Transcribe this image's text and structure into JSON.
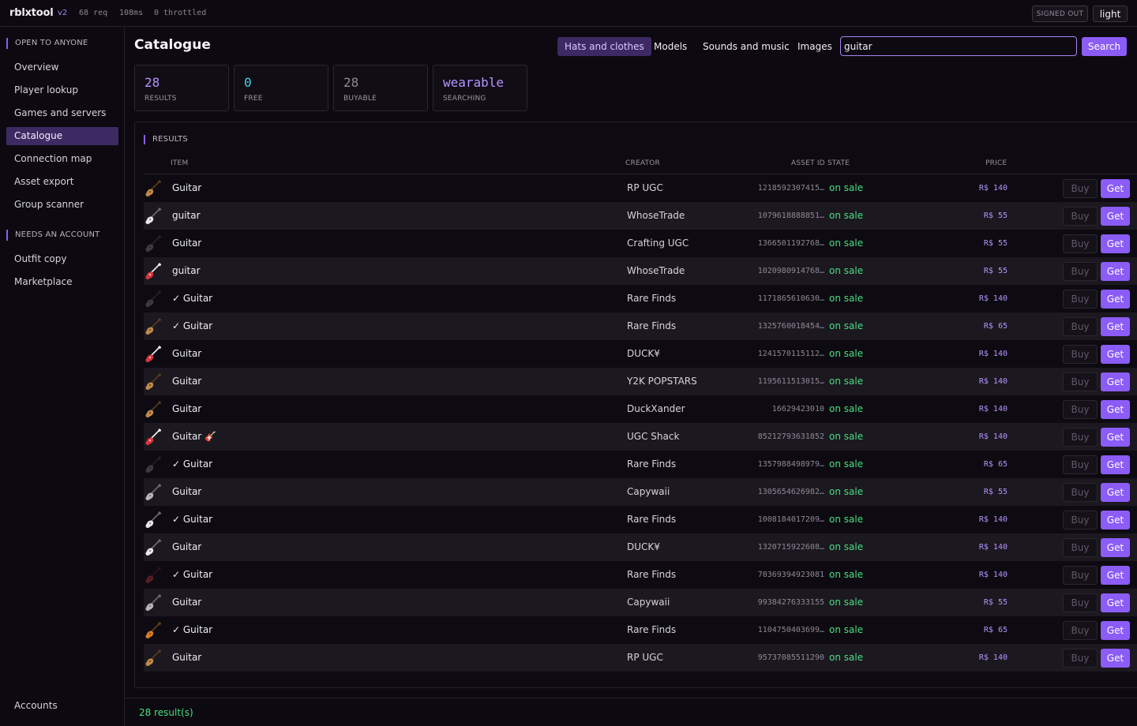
{
  "app": {
    "name": "rblxtool",
    "version": "v2",
    "requests": "68 req",
    "latency": "108ms",
    "throttled": "0 throttled",
    "auth_status": "SIGNED OUT",
    "theme_toggle": "light"
  },
  "sidebar": {
    "section_public": "OPEN TO ANYONE",
    "public_items": [
      {
        "label": "Overview"
      },
      {
        "label": "Player lookup"
      },
      {
        "label": "Games and servers"
      },
      {
        "label": "Catalogue"
      },
      {
        "label": "Connection map"
      },
      {
        "label": "Asset export"
      },
      {
        "label": "Group scanner"
      }
    ],
    "section_account": "NEEDS AN ACCOUNT",
    "account_items": [
      {
        "label": "Outfit copy"
      },
      {
        "label": "Marketplace"
      }
    ],
    "accounts_label": "Accounts"
  },
  "main": {
    "title": "Catalogue",
    "tabs": [
      {
        "label": "Hats and clothes"
      },
      {
        "label": "Models"
      },
      {
        "label": "Sounds and music"
      },
      {
        "label": "Images"
      }
    ],
    "search_value": "guitar",
    "search_button": "Search"
  },
  "stats": [
    {
      "value": "28",
      "label": "RESULTS"
    },
    {
      "value": "0",
      "label": "FREE"
    },
    {
      "value": "28",
      "label": "BUYABLE"
    },
    {
      "value": "wearable",
      "label": "SEARCHING"
    }
  ],
  "results": {
    "heading": "RESULTS",
    "columns": {
      "item": "ITEM",
      "creator": "CREATOR",
      "asset_id": "ASSET ID",
      "state": "STATE",
      "price": "PRICE"
    },
    "buy_label": "Buy",
    "get_label": "Get",
    "rows": [
      {
        "name": "Guitar",
        "creator": "RP UGC",
        "asset_id": "1218592307415…",
        "state": "on sale",
        "price": "R$ 140",
        "icon": "acoustic-guitar"
      },
      {
        "name": "guitar",
        "creator": "WhoseTrade",
        "asset_id": "1079618888851…",
        "state": "on sale",
        "price": "R$ 55",
        "icon": "white-electric-guitar"
      },
      {
        "name": "Guitar",
        "creator": "Crafting UGC",
        "asset_id": "1366501192768…",
        "state": "on sale",
        "price": "R$ 55",
        "icon": "dark-guitar"
      },
      {
        "name": "guitar",
        "creator": "WhoseTrade",
        "asset_id": "1020980914768…",
        "state": "on sale",
        "price": "R$ 55",
        "icon": "red-electric-guitar"
      },
      {
        "name": "✓ Guitar",
        "creator": "Rare Finds",
        "asset_id": "1171865610630…",
        "state": "on sale",
        "price": "R$ 140",
        "icon": "dark-guitar"
      },
      {
        "name": "✓ Guitar",
        "creator": "Rare Finds",
        "asset_id": "1325760018454…",
        "state": "on sale",
        "price": "R$ 65",
        "icon": "acoustic-guitar"
      },
      {
        "name": "Guitar",
        "creator": "DUCK¥",
        "asset_id": "1241570115112…",
        "state": "on sale",
        "price": "R$ 140",
        "icon": "red-electric-guitar"
      },
      {
        "name": "Guitar",
        "creator": "Y2K POPSTARS",
        "asset_id": "1195611513015…",
        "state": "on sale",
        "price": "R$ 140",
        "icon": "acoustic-guitar"
      },
      {
        "name": "Guitar",
        "creator": "DuckXander",
        "asset_id": "16629423010",
        "state": "on sale",
        "price": "R$ 140",
        "icon": "acoustic-guitar"
      },
      {
        "name": "Guitar 🎸",
        "creator": "UGC Shack",
        "asset_id": "85212793631852",
        "state": "on sale",
        "price": "R$ 140",
        "icon": "red-electric-guitar"
      },
      {
        "name": "✓ Guitar",
        "creator": "Rare Finds",
        "asset_id": "1357988498979…",
        "state": "on sale",
        "price": "R$ 65",
        "icon": "dark-guitar"
      },
      {
        "name": "Guitar",
        "creator": "Capywaii",
        "asset_id": "1305654626982…",
        "state": "on sale",
        "price": "R$ 55",
        "icon": "grey-guitar"
      },
      {
        "name": "✓ Guitar",
        "creator": "Rare Finds",
        "asset_id": "1008184017209…",
        "state": "on sale",
        "price": "R$ 140",
        "icon": "white-electric-guitar"
      },
      {
        "name": "Guitar",
        "creator": "DUCK¥",
        "asset_id": "1320715922608…",
        "state": "on sale",
        "price": "R$ 140",
        "icon": "white-electric-guitar"
      },
      {
        "name": "✓ Guitar",
        "creator": "Rare Finds",
        "asset_id": "70369394923081",
        "state": "on sale",
        "price": "R$ 140",
        "icon": "dark-red-guitar"
      },
      {
        "name": "Guitar",
        "creator": "Capywaii",
        "asset_id": "99384276333155",
        "state": "on sale",
        "price": "R$ 55",
        "icon": "grey-guitar"
      },
      {
        "name": "✓ Guitar",
        "creator": "Rare Finds",
        "asset_id": "1104750403699…",
        "state": "on sale",
        "price": "R$ 65",
        "icon": "orange-guitar"
      },
      {
        "name": "Guitar",
        "creator": "RP UGC",
        "asset_id": "95737085511290",
        "state": "on sale",
        "price": "R$ 140",
        "icon": "acoustic-guitar"
      }
    ]
  },
  "footer": {
    "status": "28 result(s)"
  },
  "colors": {
    "accent": "#8b5cf6",
    "accent_light": "#a884f3",
    "success": "#4ade80",
    "background": "#0c0a10"
  }
}
